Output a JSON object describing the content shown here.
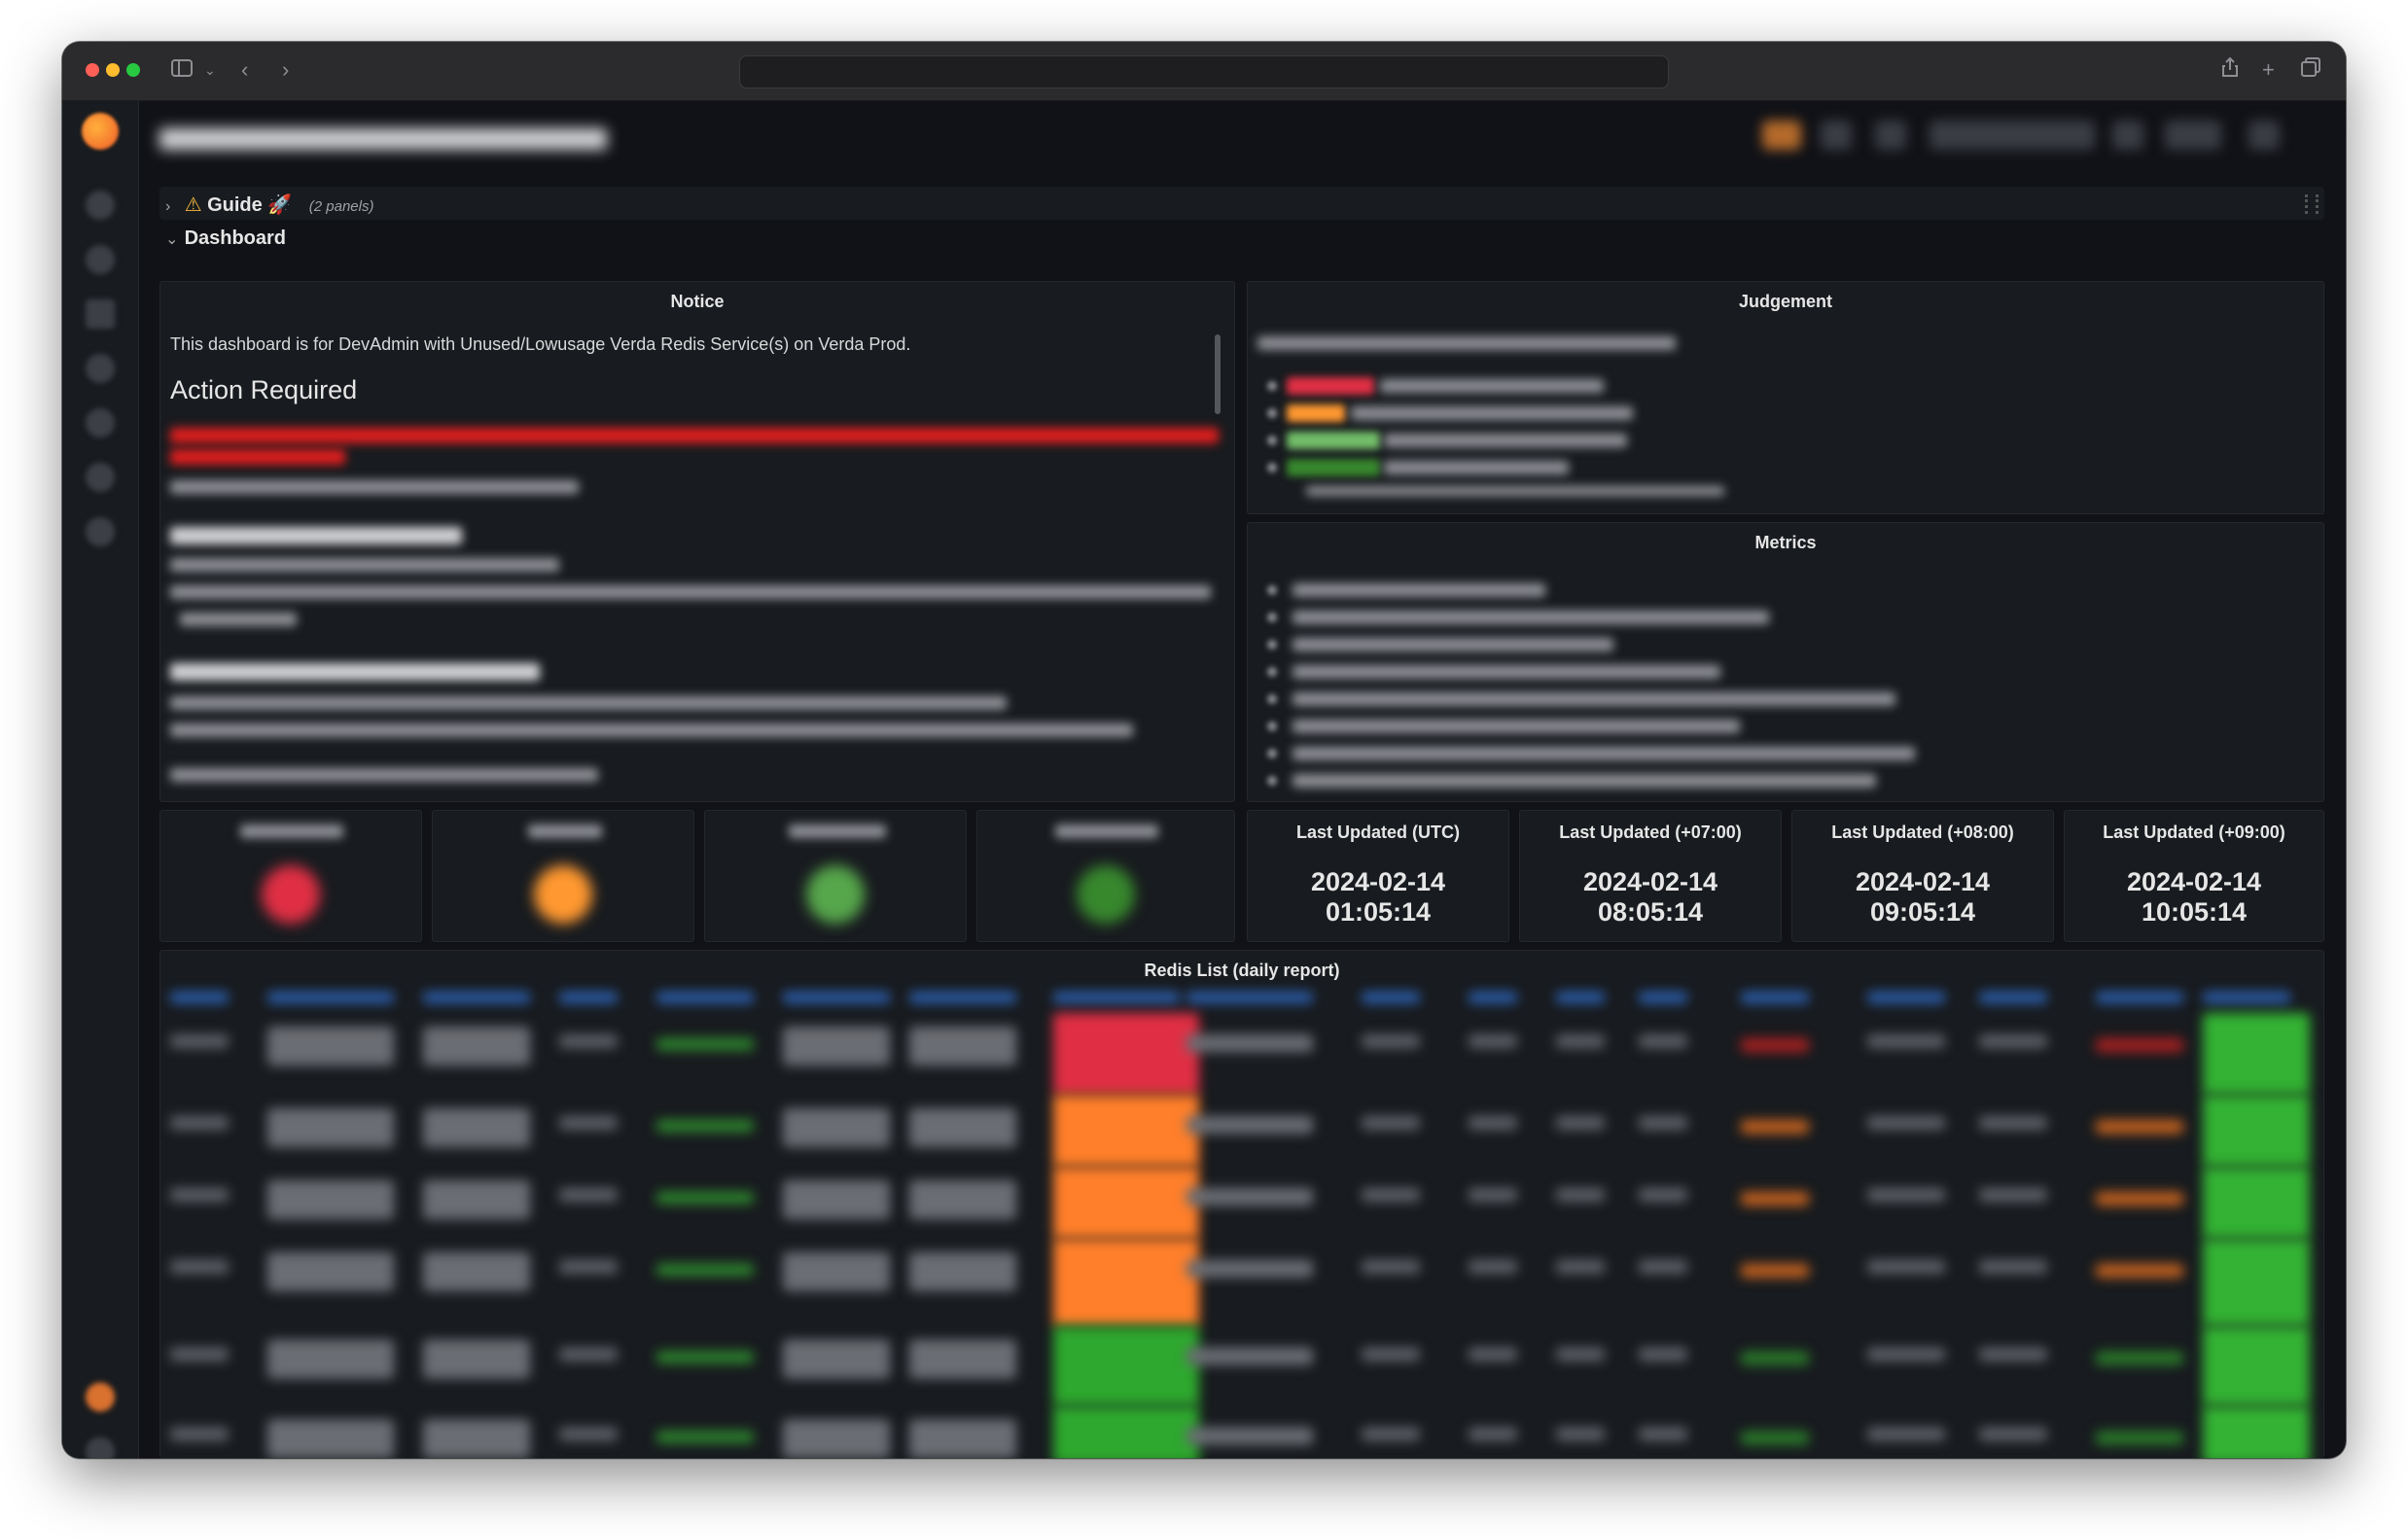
{
  "browser": {
    "address": ""
  },
  "header": {
    "breadcrumb": "",
    "time_range": ""
  },
  "rows": {
    "guide": {
      "warning_icon": "⚠",
      "title": "Guide",
      "rocket_icon": "🚀",
      "count": "(2 panels)"
    },
    "dashboard": {
      "title": "Dashboard"
    }
  },
  "notice": {
    "title": "Notice",
    "intro": "This dashboard is for DevAdmin with Unused/Lowusage Verda Redis Service(s) on Verda Prod.",
    "action_heading": "Action Required"
  },
  "judgement": {
    "title": "Judgement",
    "colors": [
      "#e02f44",
      "#ff9830",
      "#73bf69",
      "#37872d"
    ]
  },
  "metrics": {
    "title": "Metrics"
  },
  "stat_panels": [
    {
      "color": "#e02f44"
    },
    {
      "color": "#ff9830"
    },
    {
      "color": "#56a64b"
    },
    {
      "color": "#37872d"
    }
  ],
  "time_panels": [
    {
      "label": "Last Updated (UTC)",
      "date": "2024-02-14",
      "time": "01:05:14"
    },
    {
      "label": "Last Updated (+07:00)",
      "date": "2024-02-14",
      "time": "08:05:14"
    },
    {
      "label": "Last Updated (+08:00)",
      "date": "2024-02-14",
      "time": "09:05:14"
    },
    {
      "label": "Last Updated (+09:00)",
      "date": "2024-02-14",
      "time": "10:05:14"
    }
  ],
  "table": {
    "title": "Redis List (daily report)",
    "status_colors": [
      "#e02f44",
      "#ff7f2a",
      "#ff7f2a",
      "#ff7f2a",
      "#2ea82e",
      "#2ea82e"
    ],
    "header_color": "#3274d9",
    "last_col_color": "#33b233"
  }
}
